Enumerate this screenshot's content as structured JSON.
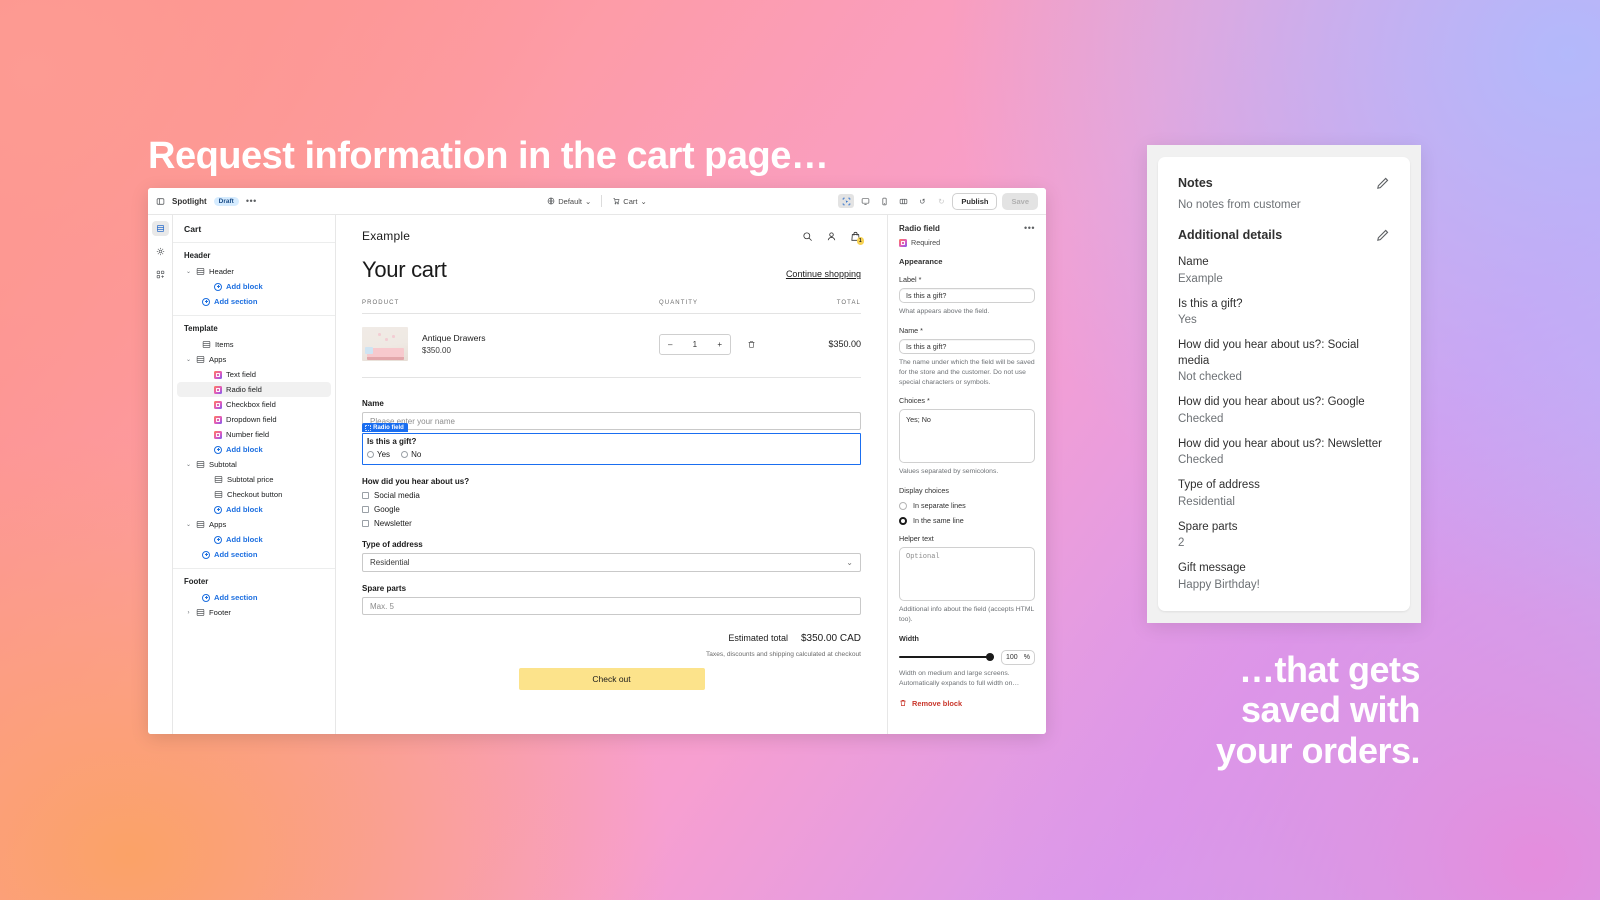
{
  "headlines": {
    "top": "Request information in the cart page…",
    "bottom_line1": "…that gets",
    "bottom_line2": "saved with",
    "bottom_line3": "your orders."
  },
  "editor": {
    "topbar": {
      "back_icon": "back-arrow-icon",
      "store_name": "Spotlight",
      "status_badge": "Draft",
      "more_label": "•••",
      "theme_selector": "Default",
      "page_selector": "Cart",
      "view_icons": [
        "inspect-cursor-icon",
        "desktop-icon",
        "mobile-icon",
        "fullwidth-icon"
      ],
      "undo_label": "↺",
      "redo_label": "↻",
      "publish_label": "Publish",
      "save_label": "Save"
    },
    "rail": {
      "items": [
        "sections-icon",
        "settings-gear-icon",
        "apps-icon"
      ]
    },
    "tree": {
      "header": "Cart",
      "groups": [
        {
          "title": "Header",
          "rows": [
            {
              "label": "Header",
              "type": "section",
              "indent": 0,
              "caret": "⌄"
            },
            {
              "label": "Add block",
              "type": "add-block",
              "indent": 2
            },
            {
              "label": "Add section",
              "type": "add-section",
              "indent": 1
            }
          ]
        },
        {
          "title": "Template",
          "rows": [
            {
              "label": "Items",
              "type": "section",
              "indent": 1
            },
            {
              "label": "Apps",
              "type": "section",
              "indent": 0,
              "caret": "⌄"
            },
            {
              "label": "Text field",
              "type": "app",
              "indent": 2
            },
            {
              "label": "Radio field",
              "type": "app",
              "indent": 2,
              "selected": true
            },
            {
              "label": "Checkbox field",
              "type": "app",
              "indent": 2
            },
            {
              "label": "Dropdown field",
              "type": "app",
              "indent": 2
            },
            {
              "label": "Number field",
              "type": "app",
              "indent": 2
            },
            {
              "label": "Add block",
              "type": "add-block",
              "indent": 2
            },
            {
              "label": "Subtotal",
              "type": "section",
              "indent": 0,
              "caret": "⌄"
            },
            {
              "label": "Subtotal price",
              "type": "block",
              "indent": 2
            },
            {
              "label": "Checkout button",
              "type": "block",
              "indent": 2
            },
            {
              "label": "Add block",
              "type": "add-block",
              "indent": 2
            },
            {
              "label": "Apps",
              "type": "section",
              "indent": 0,
              "caret": "⌄"
            },
            {
              "label": "Add block",
              "type": "add-block",
              "indent": 2
            },
            {
              "label": "Add section",
              "type": "add-section",
              "indent": 1
            }
          ]
        },
        {
          "title": "Footer",
          "rows": [
            {
              "label": "Add section",
              "type": "add-section",
              "indent": 1
            },
            {
              "label": "Footer",
              "type": "section",
              "indent": 0,
              "caret": "›"
            }
          ]
        }
      ]
    },
    "preview": {
      "store_name": "Example",
      "page_title": "Your cart",
      "continue_link": "Continue shopping",
      "table_headers": {
        "product": "PRODUCT",
        "quantity": "QUANTITY",
        "total": "TOTAL"
      },
      "cart_badge_count": "1",
      "line_item": {
        "name": "Antique Drawers",
        "price": "$350.00",
        "quantity": "1",
        "minus": "–",
        "plus": "+",
        "total": "$350.00"
      },
      "form": {
        "name_label": "Name",
        "name_placeholder": "Please enter your name",
        "selection_tag": "Radio field",
        "gift_label": "Is this a gift?",
        "gift_options": [
          "Yes",
          "No"
        ],
        "hear_label": "How did you hear about us?",
        "hear_options": [
          "Social media",
          "Google",
          "Newsletter"
        ],
        "address_label": "Type of address",
        "address_value": "Residential",
        "spare_label": "Spare parts",
        "spare_placeholder": "Max. 5"
      },
      "totals": {
        "label": "Estimated total",
        "value": "$350.00 CAD",
        "note": "Taxes, discounts and shipping calculated at checkout",
        "checkout_label": "Check out"
      }
    },
    "settings": {
      "title": "Radio field",
      "more_label": "•••",
      "required_label": "Required",
      "appearance_heading": "Appearance",
      "label_label": "Label *",
      "label_value": "Is this a gift?",
      "label_help": "What appears above the field.",
      "name_label": "Name *",
      "name_value": "Is this a gift?",
      "name_help": "The name under which the field will be saved for the store and the customer. Do not use special characters or symbols.",
      "choices_label": "Choices *",
      "choices_value": "Yes; No",
      "choices_help": "Values separated by semicolons.",
      "display_label": "Display choices",
      "display_options": [
        {
          "label": "In separate lines",
          "selected": false
        },
        {
          "label": "In the same line",
          "selected": true
        }
      ],
      "helper_label": "Helper text",
      "helper_placeholder": "Optional",
      "helper_help": "Additional info about the field (accepts HTML too).",
      "width_label": "Width",
      "width_value": "100",
      "width_unit": "%",
      "width_help": "Width on medium and large screens. Automatically expands to full width on…",
      "remove_label": "Remove block"
    }
  },
  "notes_card": {
    "notes_title": "Notes",
    "notes_empty": "No notes from customer",
    "details_title": "Additional details",
    "details": [
      {
        "label": "Name",
        "value": "Example"
      },
      {
        "label": "Is this a gift?",
        "value": "Yes"
      },
      {
        "label": "How did you hear about us?: Social media",
        "value": "Not checked"
      },
      {
        "label": "How did you hear about us?: Google",
        "value": "Checked"
      },
      {
        "label": "How did you hear about us?: Newsletter",
        "value": "Checked"
      },
      {
        "label": "Type of address",
        "value": "Residential"
      },
      {
        "label": "Spare parts",
        "value": "2"
      },
      {
        "label": "Gift message",
        "value": "Happy Birthday!"
      }
    ]
  }
}
